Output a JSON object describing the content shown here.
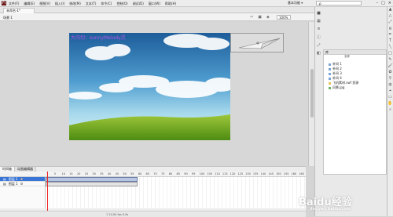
{
  "app": {
    "logo": "Fl",
    "menu": [
      "文件(F)",
      "编辑(E)",
      "视图(V)",
      "插入(I)",
      "修改(M)",
      "文本(T)",
      "命令(C)",
      "控制(O)",
      "调试(D)",
      "窗口(W)",
      "帮助(H)"
    ],
    "workspace": "基本功能 ▾",
    "search_placeholder": "ρ",
    "window_buttons": [
      "–",
      "□",
      "×"
    ]
  },
  "document": {
    "tab": "未命名-1*",
    "scene": "场景 1",
    "zoom": "100%"
  },
  "stage": {
    "overlay_text": "大沟切：sunnyMelody灵"
  },
  "timeline": {
    "tabs": [
      "时间轴",
      "动画编辑器"
    ],
    "ruler": [
      "1",
      "5",
      "10",
      "15",
      "20",
      "25",
      "30",
      "35",
      "40",
      "45",
      "50",
      "55",
      "60",
      "65",
      "70",
      "75",
      "80",
      "85",
      "90",
      "95",
      "100",
      "105",
      "110",
      "115",
      "120",
      "125",
      "130",
      "135",
      "140",
      "145",
      "150",
      "155",
      "160",
      "165"
    ],
    "layers": [
      "图层 2",
      "图层 1"
    ],
    "status": "1   24.00 fps   0.0s"
  },
  "library": {
    "header": "库",
    "column": "名称",
    "items": [
      "补间 1",
      "补间 2",
      "补间 3",
      "补间 4",
      "飞机素材.swf 资源",
      "风景.jpg"
    ]
  },
  "watermark": {
    "text": "Baidu经验",
    "sub": "jingyan.baidu.com"
  }
}
